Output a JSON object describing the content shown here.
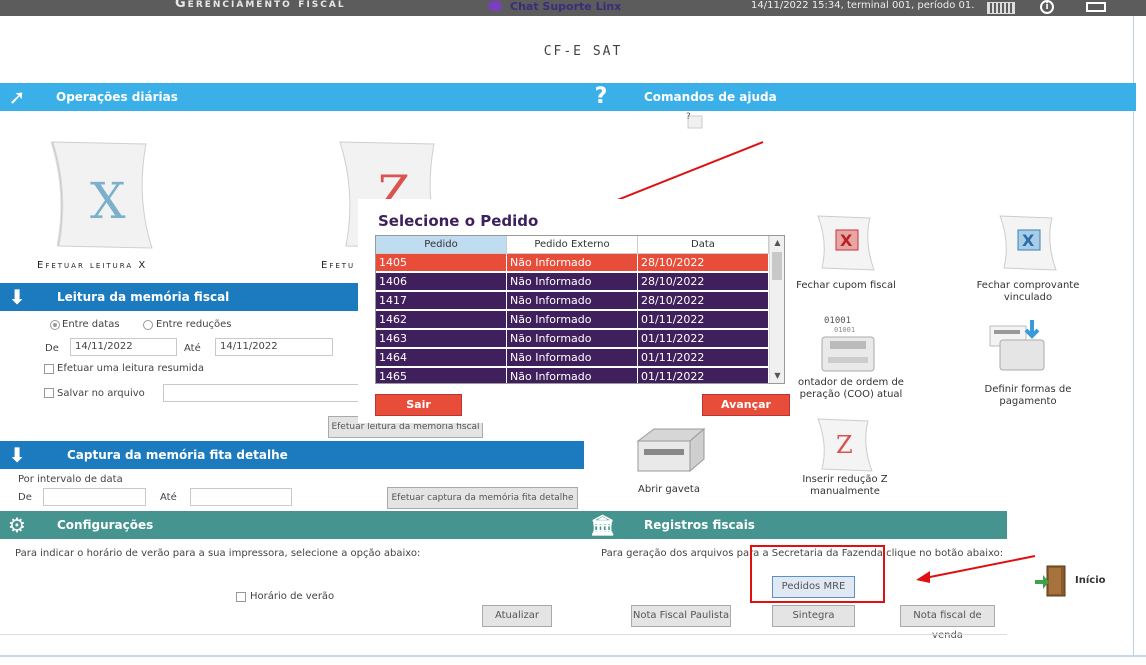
{
  "topbar": {
    "title": "Gerenciamento fiscal",
    "chat": "Chat Suporte Linx",
    "info": "14/11/2022 15:34, terminal 001, período 01."
  },
  "app_title": "CF-E SAT",
  "operacoes": {
    "header": "Operações diárias",
    "leitura_x": "Efetuar leitura X",
    "leitura_z_partial": "Efetu"
  },
  "comandos": {
    "header": "Comandos de ajuda",
    "fechar_cupom": "Fechar cupom fiscal",
    "fechar_comprovante": "Fechar comprovante vinculado",
    "contador_coo": "ontador de ordem de peração (COO) atual",
    "definir_formas": "Definir formas de pagamento",
    "abrir_gaveta": "Abrir gaveta",
    "inserir_z": "Inserir redução Z manualmente",
    "coo_digits_top": "01001",
    "coo_digits_bottom": "01001"
  },
  "leitura_memoria": {
    "header": "Leitura da memória fiscal",
    "entre_datas": "Entre datas",
    "entre_reducoes": "Entre reduções",
    "de_label": "De",
    "de_value": "14/11/2022",
    "ate_label": "Até",
    "ate_value": "14/11/2022",
    "leitura_resumida": "Efetuar uma leitura resumida",
    "salvar_arquivo": "Salvar no arquivo",
    "efetuar_btn": "Efetuar leitura da memória fiscal"
  },
  "captura": {
    "header": "Captura da memória fita detalhe",
    "por_intervalo": "Por intervalo de data",
    "de_label": "De",
    "ate_label": "Até",
    "efetuar_btn": "Efetuar captura da memória fita detalhe"
  },
  "configuracoes": {
    "header": "Configurações",
    "text": "Para indicar o horário de verão para a sua impressora, selecione a opção abaixo:",
    "horario_verao": "Horário de verão",
    "atualizar": "Atualizar"
  },
  "registros": {
    "header": "Registros fiscais",
    "text": "Para geração dos arquivos para a Secretaria da Fazenda clique no botão abaixo:",
    "pedidos_mre": "Pedidos MRE",
    "nota_paulista": "Nota Fiscal Paulista",
    "sintegra": "Sintegra",
    "nota_venda": "Nota fiscal de venda"
  },
  "inicio": "Início",
  "modal": {
    "title": "Selecione o Pedido",
    "columns": [
      "Pedido",
      "Pedido Externo",
      "Data"
    ],
    "rows": [
      [
        "1405",
        "Não Informado",
        "28/10/2022"
      ],
      [
        "1406",
        "Não Informado",
        "28/10/2022"
      ],
      [
        "1417",
        "Não Informado",
        "28/10/2022"
      ],
      [
        "1462",
        "Não Informado",
        "01/11/2022"
      ],
      [
        "1463",
        "Não Informado",
        "01/11/2022"
      ],
      [
        "1464",
        "Não Informado",
        "01/11/2022"
      ],
      [
        "1465",
        "Não Informado",
        "01/11/2022"
      ]
    ],
    "sair": "Sair",
    "avancar": "Avançar"
  },
  "colors": {
    "selected_row": "#e84d3a",
    "row": "#40205c",
    "header_sky": "#3bb0e8",
    "header_navy": "#1c7bbf",
    "header_teal": "#45948f",
    "annotation": "#e01010"
  }
}
